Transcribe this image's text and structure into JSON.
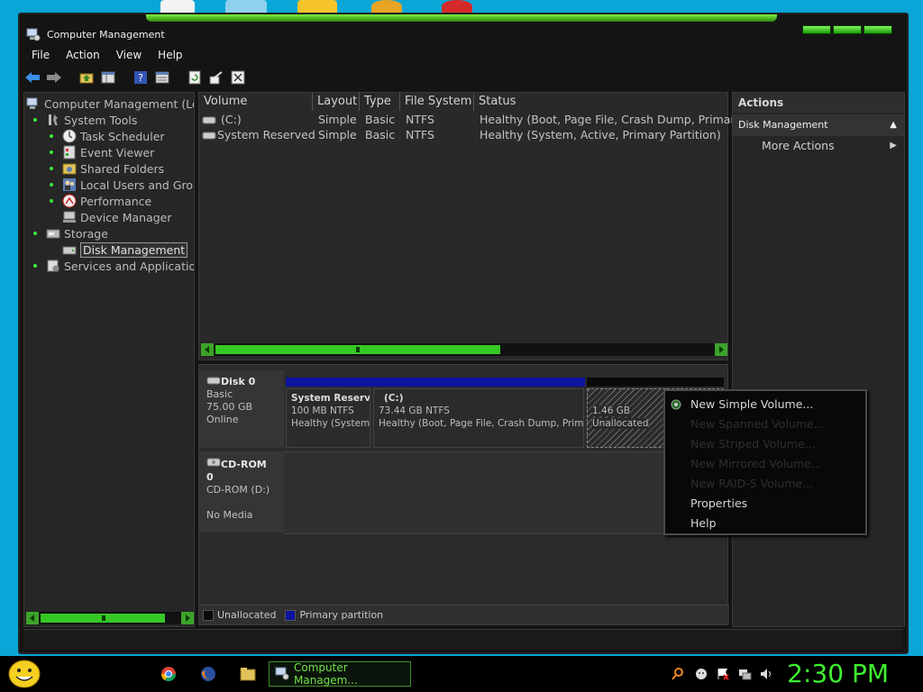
{
  "window": {
    "title": "Computer Management"
  },
  "menu": [
    "File",
    "Action",
    "View",
    "Help"
  ],
  "toolbar": [
    "back-icon",
    "forward-icon",
    "up-folder-icon",
    "show-hide-tree-icon",
    "help-icon",
    "details-icon",
    "refresh-icon",
    "export-icon",
    "properties-icon"
  ],
  "tree": {
    "root": "Computer Management (Loc",
    "system_tools": "System Tools",
    "task_scheduler": "Task Scheduler",
    "event_viewer": "Event Viewer",
    "shared_folders": "Shared Folders",
    "local_users": "Local Users and Grou",
    "performance": "Performance",
    "device_manager": "Device Manager",
    "storage": "Storage",
    "disk_management": "Disk Management",
    "services": "Services and Application:"
  },
  "volumes": {
    "headers": [
      "Volume",
      "Layout",
      "Type",
      "File System",
      "Status"
    ],
    "rows": [
      {
        "volume": "(C:)",
        "layout": "Simple",
        "type": "Basic",
        "fs": "NTFS",
        "status": "Healthy (Boot, Page File, Crash Dump, Primary"
      },
      {
        "volume": "System Reserved",
        "layout": "Simple",
        "type": "Basic",
        "fs": "NTFS",
        "status": "Healthy (System, Active, Primary Partition)"
      }
    ]
  },
  "disks": {
    "disk0": {
      "name": "Disk 0",
      "type": "Basic",
      "size": "75.00 GB",
      "state": "Online",
      "partitions": [
        {
          "name": "System Reserv",
          "size": "100 MB NTFS",
          "status": "Healthy (System,"
        },
        {
          "name": "(C:)",
          "size": "73.44 GB NTFS",
          "status": "Healthy (Boot, Page File, Crash Dump, Primary"
        },
        {
          "name": "",
          "size": "1.46 GB",
          "status": "Unallocated"
        }
      ]
    },
    "cdrom0": {
      "name": "CD-ROM 0",
      "type": "CD-ROM (D:)",
      "media": "No Media"
    }
  },
  "legend": {
    "unallocated": "Unallocated",
    "primary": "Primary partition"
  },
  "actions": {
    "header": "Actions",
    "section": "Disk Management",
    "more": "More Actions"
  },
  "context_menu": {
    "new_simple": "New Simple Volume...",
    "new_spanned": "New Spanned Volume...",
    "new_striped": "New Striped Volume...",
    "new_mirrored": "New Mirrored Volume...",
    "new_raid5": "New RAID-5 Volume...",
    "properties": "Properties",
    "help": "Help"
  },
  "taskbar": {
    "task_label": "Computer Managem...",
    "clock": "2:30 PM",
    "pinned": [
      "chrome-icon",
      "firefox-icon",
      "folder-icon"
    ],
    "tray": [
      "search-icon",
      "messenger-icon",
      "flag-icon",
      "network-icon",
      "volume-icon"
    ]
  },
  "colors": {
    "accent_green": "#3ef02e",
    "primary_partition": "#0c14a0",
    "unallocated": "#0a0a0a"
  }
}
